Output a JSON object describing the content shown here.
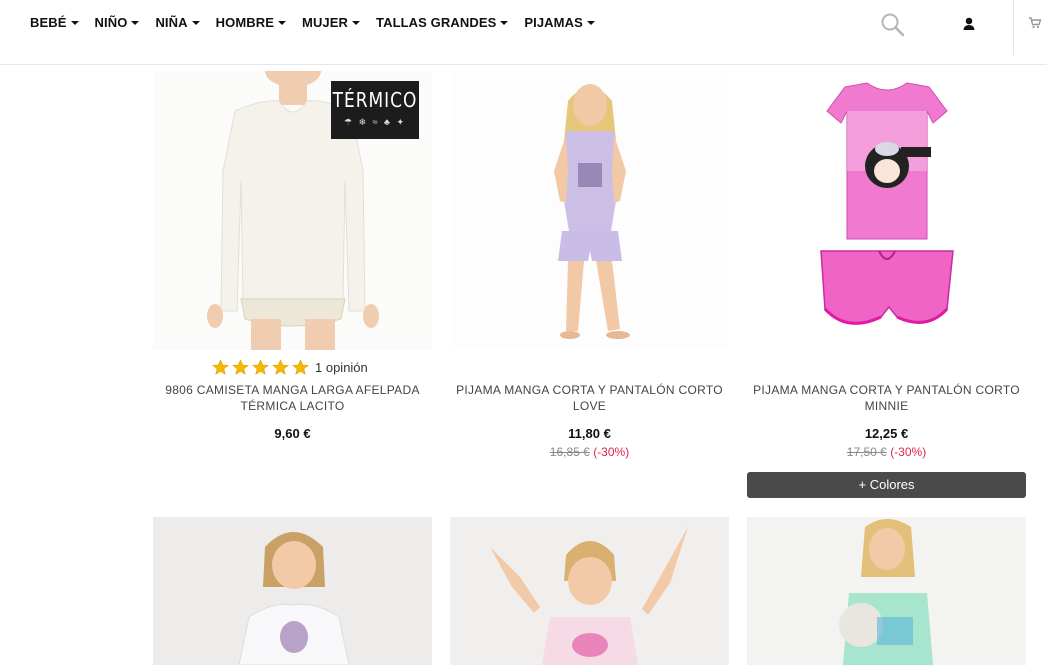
{
  "nav": {
    "items": [
      {
        "label": "BEBÉ"
      },
      {
        "label": "NIÑO"
      },
      {
        "label": "NIÑA"
      },
      {
        "label": "HOMBRE"
      },
      {
        "label": "MUJER"
      },
      {
        "label": "TALLAS GRANDES"
      },
      {
        "label": "PIJAMAS"
      }
    ]
  },
  "icons": {
    "search": "search-icon",
    "user": "user-icon",
    "cart": "cart-icon"
  },
  "products": [
    {
      "name": "9806 CAMISETA MANGA LARGA AFELPADA TÉRMICA LACITO",
      "price": "9,60 €",
      "rating_text": "1 opinión",
      "stars": 5,
      "badge_title": "TÉRMICO"
    },
    {
      "name": "PIJAMA MANGA CORTA Y PANTALÓN CORTO LOVE",
      "price": "11,80 €",
      "old_price": "16,85 €",
      "discount": "(-30%)"
    },
    {
      "name": "PIJAMA MANGA CORTA Y PANTALÓN CORTO MINNIE",
      "price": "12,25 €",
      "old_price": "17,50 €",
      "discount": "(-30%)",
      "colors_button": "+ Colores"
    }
  ],
  "colors": {
    "accent_discount": "#e0254a",
    "colors_button_bg": "#4a4a4a",
    "star": "#f5b800"
  }
}
